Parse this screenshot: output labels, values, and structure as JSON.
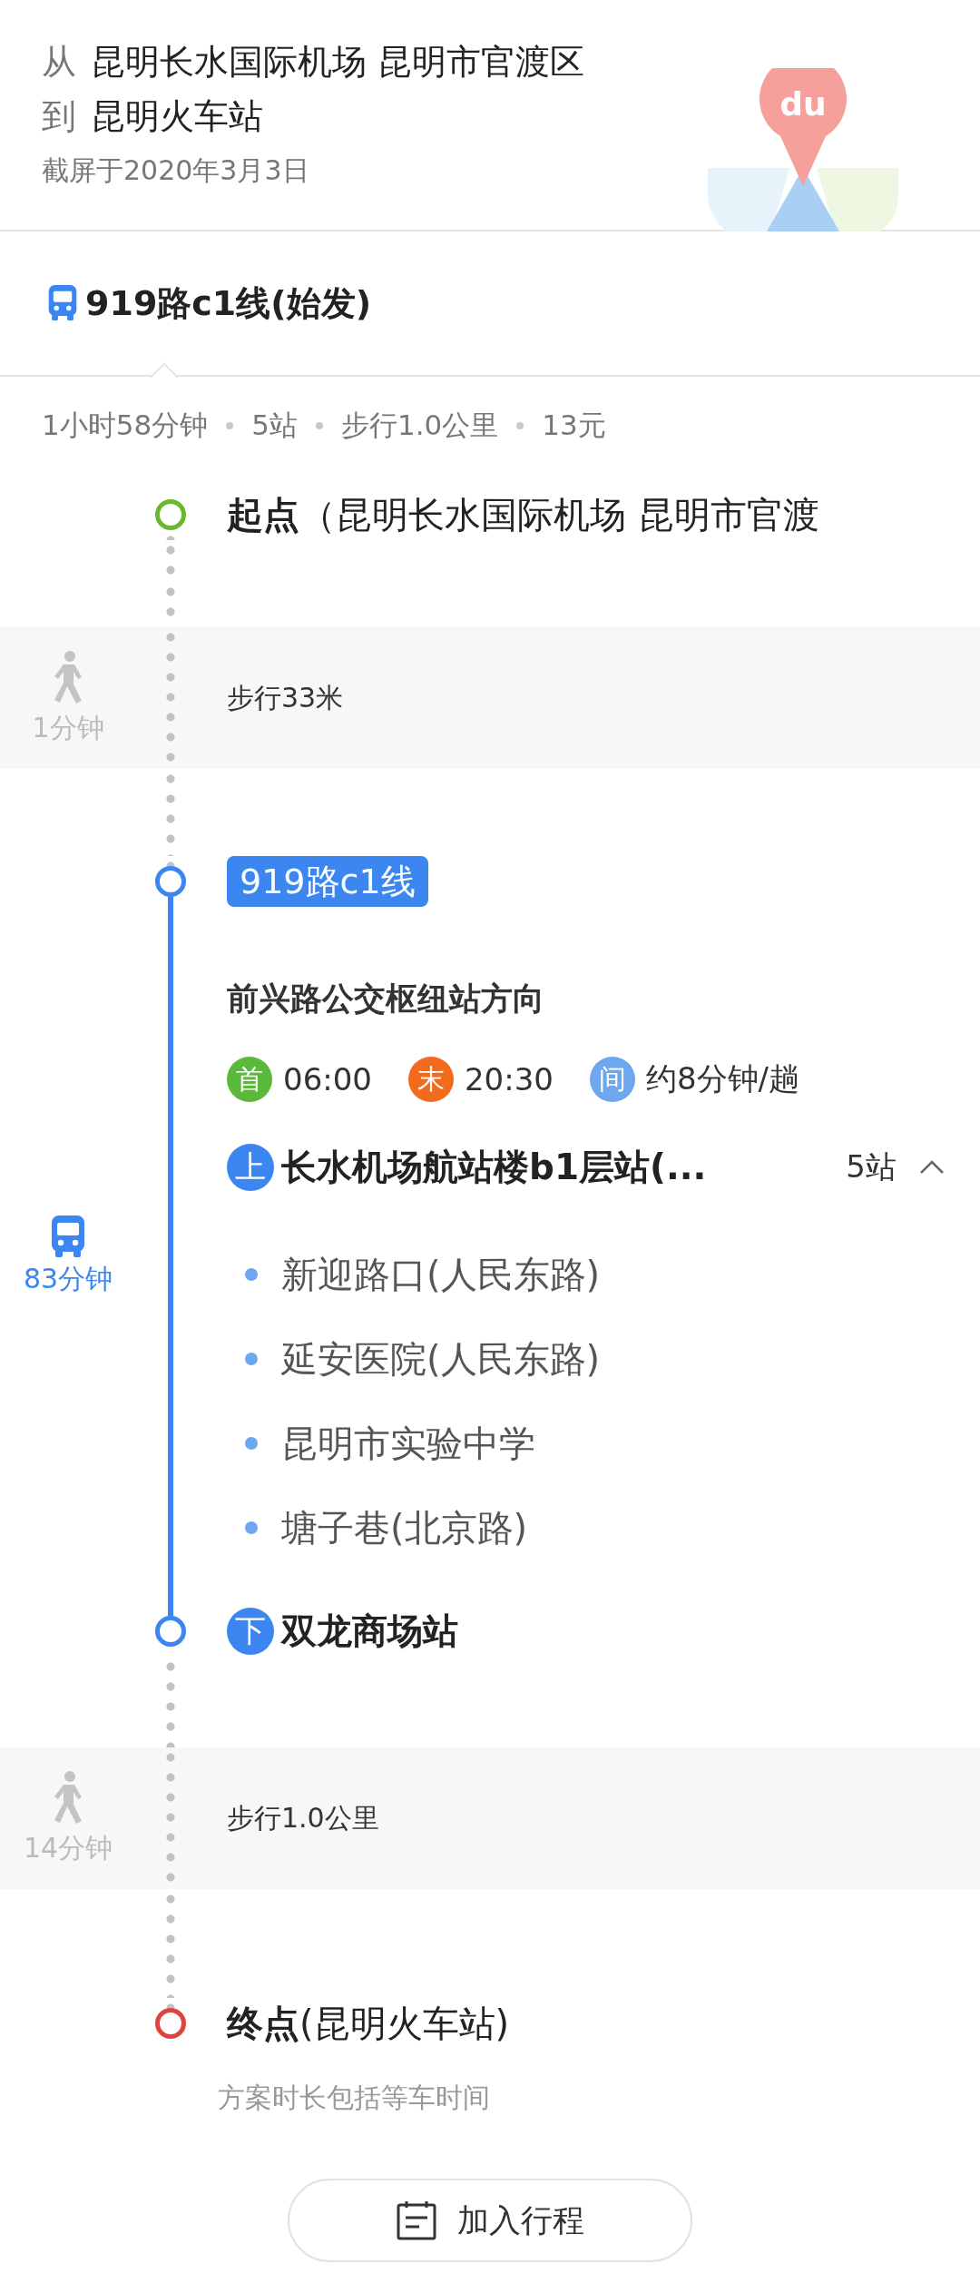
{
  "header": {
    "from_label": "从",
    "from": "昆明长水国际机场 昆明市官渡区",
    "to_label": "到",
    "to": "昆明火车站",
    "caption": "截屏于2020年3月3日",
    "logo_text": "du"
  },
  "route_tab": {
    "title": "919路c1线(始发)"
  },
  "summary": [
    "1小时58分钟",
    "5站",
    "步行1.0公里",
    "13元"
  ],
  "timeline": [
    {
      "kind": "endpoint",
      "label": "起点",
      "detail": "（昆明长水国际机场 昆明市官渡",
      "color": "#6ab82e"
    },
    {
      "kind": "walk",
      "duration": "1分钟",
      "text": "步行33米"
    },
    {
      "kind": "bus",
      "duration": "83分钟",
      "line": "919路c1线",
      "direction": "前兴路公交枢纽站方向",
      "times": [
        {
          "badge": "首",
          "time": "06:00",
          "color": "#5cb83a"
        },
        {
          "badge": "末",
          "time": "20:30",
          "color": "#f26b1d"
        },
        {
          "badge": "间",
          "time": "约8分钟/趟",
          "color": "#6ea6ef"
        }
      ],
      "board": {
        "badge": "上",
        "name": "长水机场航站楼b1层站(...",
        "count": "5站",
        "expanded": true
      },
      "stops": [
        "新迎路口(人民东路)",
        "延安医院(人民东路)",
        "昆明市实验中学",
        "塘子巷(北京路)"
      ],
      "alight": {
        "badge": "下",
        "name": "双龙商场站"
      }
    },
    {
      "kind": "walk",
      "duration": "14分钟",
      "text": "步行1.0公里"
    },
    {
      "kind": "endpoint",
      "label": "终点",
      "detail": "(昆明火车站)",
      "color": "#e0443e",
      "note": "方案时长包括等车时间"
    }
  ],
  "button": {
    "label": "加入行程"
  }
}
